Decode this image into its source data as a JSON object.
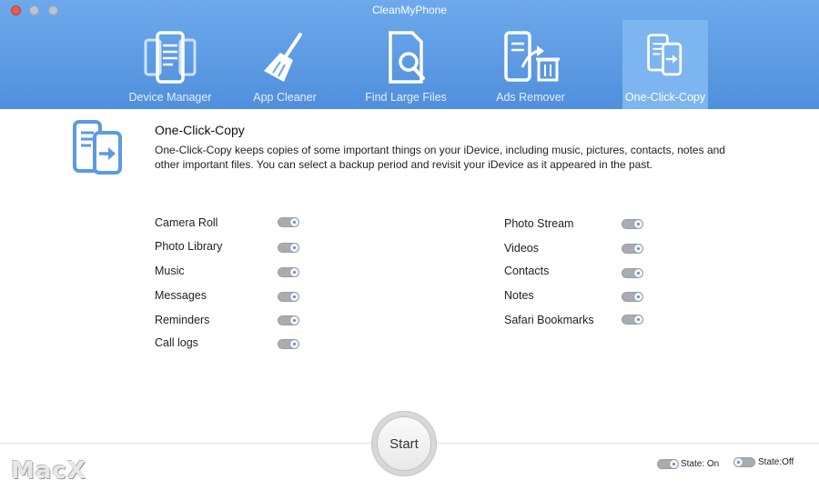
{
  "window": {
    "title": "CleanMyPhone"
  },
  "toolbar": {
    "items": [
      {
        "label": "Device Manager",
        "icon": "phones-icon",
        "selected": false
      },
      {
        "label": "App Cleaner",
        "icon": "broom-icon",
        "selected": false
      },
      {
        "label": "Find Large Files",
        "icon": "document-search-icon",
        "selected": false
      },
      {
        "label": "Ads Remover",
        "icon": "phone-trash-icon",
        "selected": false
      },
      {
        "label": "One-Click-Copy",
        "icon": "phone-copy-icon",
        "selected": true
      }
    ]
  },
  "section": {
    "title": "One-Click-Copy",
    "description": "One-Click-Copy keeps copies of some important things on your iDevice, including music, pictures, contacts, notes and other important files. You can select a backup period and revisit your iDevice as it appeared in the past."
  },
  "options_left": [
    {
      "label": "Camera Roll",
      "state": "on"
    },
    {
      "label": "Photo Library",
      "state": "on"
    },
    {
      "label": "Music",
      "state": "on"
    },
    {
      "label": "Messages",
      "state": "on"
    },
    {
      "label": "Reminders",
      "state": "on"
    },
    {
      "label": "Call logs",
      "state": "on"
    }
  ],
  "options_right": [
    {
      "label": "Photo Stream",
      "state": "on"
    },
    {
      "label": "Videos",
      "state": "on"
    },
    {
      "label": "Contacts",
      "state": "on"
    },
    {
      "label": "Notes",
      "state": "on"
    },
    {
      "label": "Safari Bookmarks",
      "state": "on"
    }
  ],
  "start_button": {
    "label": "Start"
  },
  "legend": {
    "on_label": "State: On",
    "off_label": "State:Off"
  },
  "watermark": {
    "text": "MacX"
  },
  "colors": {
    "toolbar": "#5a98e2",
    "selected_tab": "#7db5f1",
    "accent": "#4a90e2"
  }
}
